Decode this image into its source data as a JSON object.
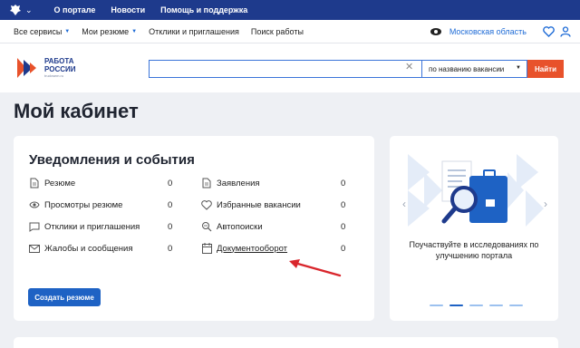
{
  "topbar": {
    "links": [
      "О портале",
      "Новости",
      "Помощь и поддержка"
    ]
  },
  "navbar": {
    "services": "Все сервисы",
    "resumes": "Мои резюме",
    "responses": "Отклики и приглашения",
    "job_search": "Поиск работы",
    "region": "Московская область"
  },
  "brand": {
    "line1": "РАБОТА",
    "line2": "РОССИИ",
    "line3": "trudvsem.ru"
  },
  "search": {
    "value": "",
    "scope": "по названию вакансии",
    "button": "Найти"
  },
  "page": {
    "title": "Мой кабинет"
  },
  "notifications": {
    "title": "Уведомления и события",
    "left": [
      {
        "label": "Резюме",
        "count": "0",
        "icon": "document-icon"
      },
      {
        "label": "Просмотры резюме",
        "count": "0",
        "icon": "eye-icon"
      },
      {
        "label": "Отклики и приглашения",
        "count": "0",
        "icon": "chat-icon"
      },
      {
        "label": "Жалобы и сообщения",
        "count": "0",
        "icon": "envelope-icon"
      }
    ],
    "right": [
      {
        "label": "Заявления",
        "count": "0",
        "icon": "document-icon"
      },
      {
        "label": "Избранные вакансии",
        "count": "0",
        "icon": "heart-icon"
      },
      {
        "label": "Автопоиски",
        "count": "0",
        "icon": "autosearch-icon"
      },
      {
        "label": "Документооборот",
        "count": "0",
        "icon": "calendar-icon"
      }
    ],
    "create_button": "Создать резюме"
  },
  "promo": {
    "caption": "Поучаствуйте в исследованиях по улучшению портала",
    "slides": 5,
    "active_slide": 2
  },
  "colors": {
    "topbar": "#1e3a8c",
    "link": "#1e6bd6",
    "primary": "#1e62c4",
    "accent": "#e8522b",
    "annotation": "#d9262c"
  }
}
